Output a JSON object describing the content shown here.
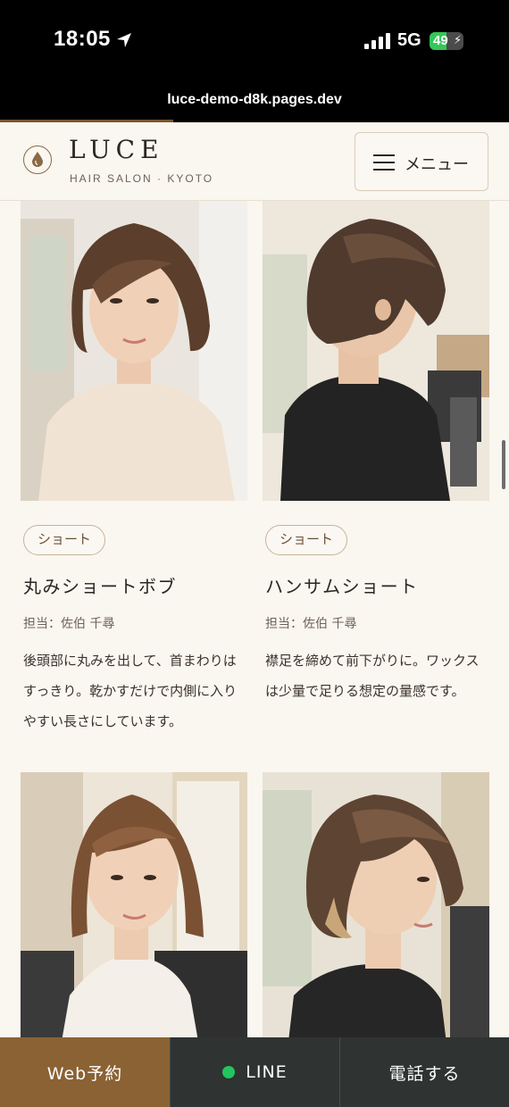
{
  "status_bar": {
    "time": "18:05",
    "network": "5G",
    "battery": "49",
    "battery_level": 0.49
  },
  "browser": {
    "url": "luce-demo-d8k.pages.dev",
    "load_progress": 0.34
  },
  "header": {
    "brand": "LUCE",
    "subtitle": "HAIR SALON · KYOTO",
    "menu_label": "メニュー"
  },
  "styles": [
    {
      "tag": "ショート",
      "title": "丸みショートボブ",
      "stylist": "担当：佐伯 千尋",
      "description": "後頭部に丸みを出して、首まわりはすっきり。乾かすだけで内側に入りやすい長さにしています。"
    },
    {
      "tag": "ショート",
      "title": "ハンサムショート",
      "stylist": "担当：佐伯 千尋",
      "description": "襟足を締めて前下がりに。ワックスは少量で足りる想定の量感です。"
    }
  ],
  "cta": {
    "reserve": "Web予約",
    "line": "LINE",
    "phone": "電話する"
  },
  "colors": {
    "accent": "#8b6234",
    "dark": "#2f3331",
    "line_green": "#22c55e",
    "background": "#faf6f0"
  },
  "icons": [
    "location-arrow-icon",
    "signal-icon",
    "battery-icon",
    "logo-drop-icon",
    "hamburger-icon"
  ]
}
